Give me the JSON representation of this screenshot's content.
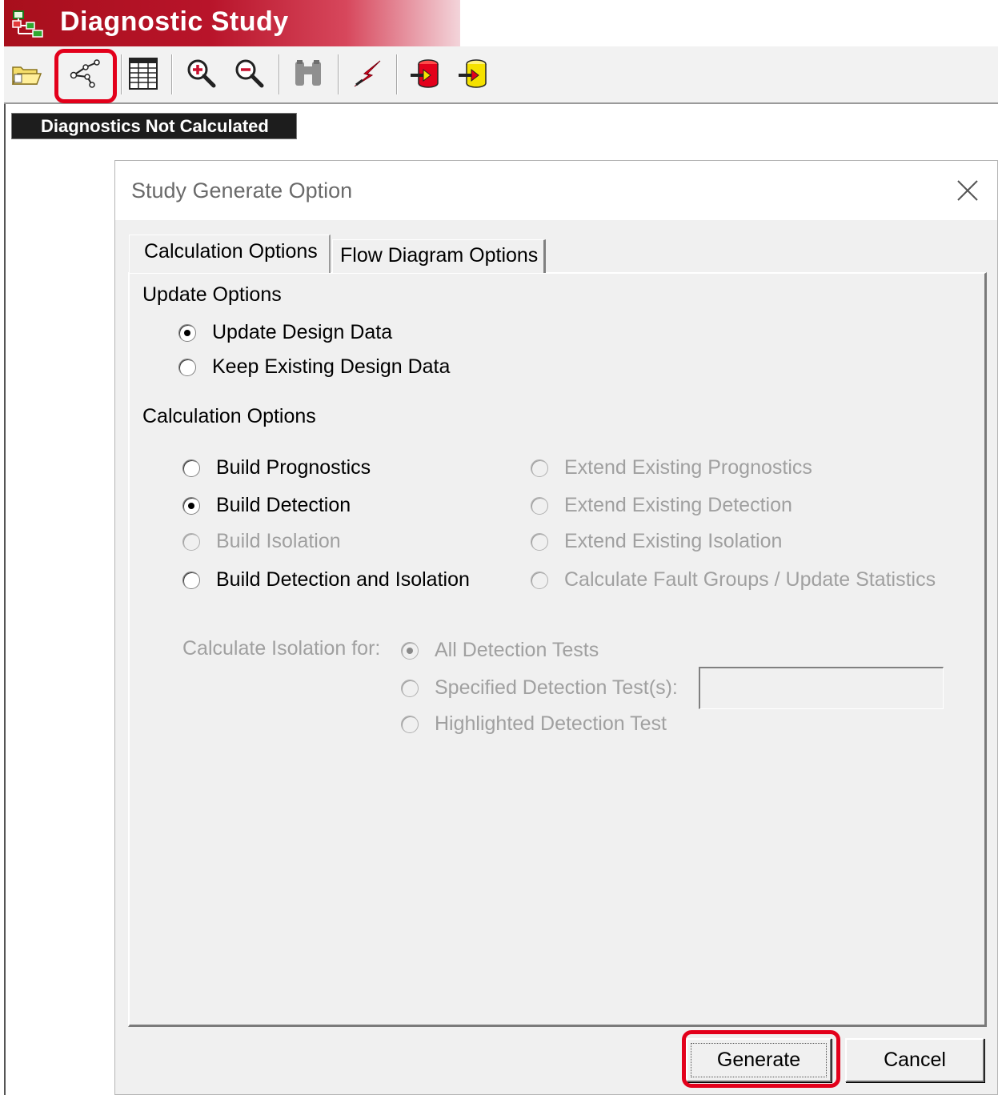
{
  "window": {
    "title": "Diagnostic Study",
    "icon": "study-tree-icon",
    "brand_color": "#b01024"
  },
  "toolbar": {
    "buttons": [
      {
        "name": "open-folder-icon"
      },
      {
        "name": "generate-study-icon",
        "highlighted": true
      },
      {
        "name": "table-view-icon"
      },
      {
        "name": "zoom-in-icon"
      },
      {
        "name": "zoom-out-icon"
      },
      {
        "name": "find-binoculars-icon"
      },
      {
        "name": "lightning-icon"
      },
      {
        "name": "import-red-icon"
      },
      {
        "name": "import-yellow-icon"
      }
    ],
    "highlight_color": "#e3001b"
  },
  "status": {
    "text": "Diagnostics Not Calculated"
  },
  "dialog": {
    "title": "Study Generate Option",
    "tabs": [
      {
        "label": "Calculation Options",
        "active": true
      },
      {
        "label": "Flow Diagram Options",
        "active": false
      }
    ],
    "update_options": {
      "label": "Update Options",
      "options": [
        {
          "label": "Update Design Data",
          "selected": true,
          "enabled": true
        },
        {
          "label": "Keep Existing Design Data",
          "selected": false,
          "enabled": true
        }
      ]
    },
    "calculation_options": {
      "label": "Calculation Options",
      "left": [
        {
          "label": "Build Prognostics",
          "selected": false,
          "enabled": true
        },
        {
          "label": "Build Detection",
          "selected": true,
          "enabled": true
        },
        {
          "label": "Build Isolation",
          "selected": false,
          "enabled": false
        },
        {
          "label": "Build Detection and Isolation",
          "selected": false,
          "enabled": true
        }
      ],
      "right": [
        {
          "label": "Extend Existing Prognostics",
          "selected": false,
          "enabled": false
        },
        {
          "label": "Extend Existing Detection",
          "selected": false,
          "enabled": false
        },
        {
          "label": "Extend Existing Isolation",
          "selected": false,
          "enabled": false
        },
        {
          "label": "Calculate Fault Groups / Update Statistics",
          "selected": false,
          "enabled": false
        }
      ]
    },
    "isolation": {
      "label": "Calculate Isolation for:",
      "options": [
        {
          "label": "All Detection Tests",
          "selected": true,
          "enabled": false
        },
        {
          "label": "Specified Detection Test(s):",
          "selected": false,
          "enabled": false
        },
        {
          "label": "Highlighted Detection Test",
          "selected": false,
          "enabled": false
        }
      ],
      "tests_value": ""
    },
    "buttons": {
      "generate": "Generate",
      "cancel": "Cancel"
    }
  }
}
